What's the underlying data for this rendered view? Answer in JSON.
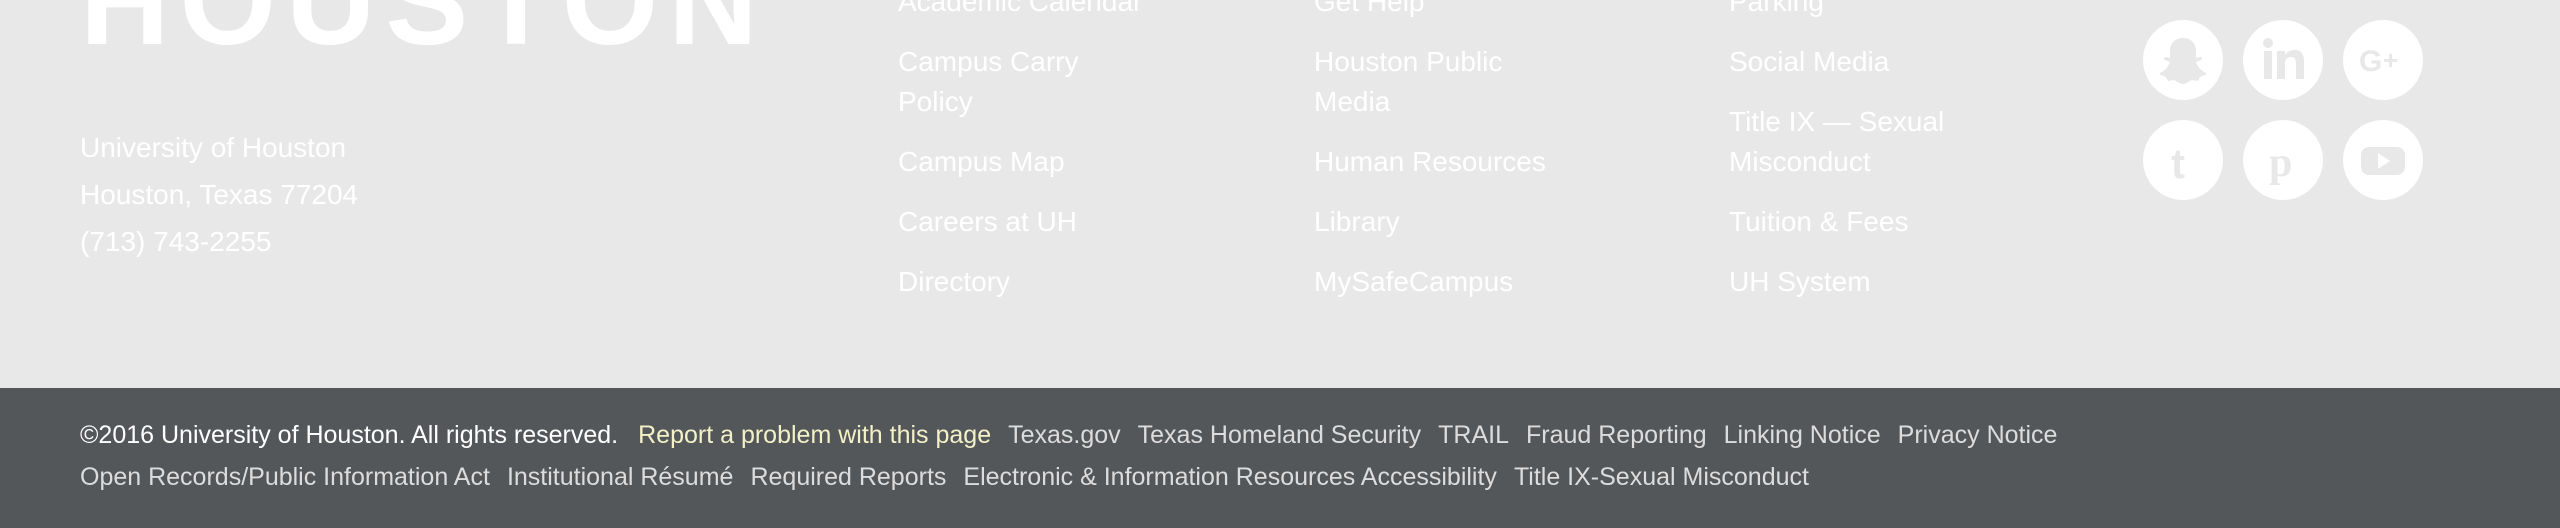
{
  "brand": {
    "logo_text": "HOUSTON"
  },
  "address": {
    "line1": "University of Houston",
    "line2": "Houston, Texas 77204",
    "phone": "(713) 743-2255"
  },
  "columns": [
    {
      "links": [
        "Academic Calendar",
        "Campus Carry Policy",
        "Campus Map",
        "Careers at UH",
        "Directory"
      ]
    },
    {
      "links": [
        "Get Help",
        "Houston Public Media",
        "Human Resources",
        "Library",
        "MySafeCampus"
      ]
    },
    {
      "links": [
        "Parking",
        "Social Media",
        "Title IX — Sexual Misconduct",
        "Tuition & Fees",
        "UH System"
      ]
    }
  ],
  "social": {
    "icons": [
      "snapchat-icon",
      "linkedin-icon",
      "google-plus-icon",
      "tumblr-icon",
      "pinterest-icon",
      "youtube-icon"
    ]
  },
  "legal": {
    "copyright": "©2016 University of Houston. All rights reserved.",
    "report_link": "Report a problem with this page",
    "links_row1": [
      "Texas.gov",
      "Texas Homeland Security",
      "TRAIL",
      "Fraud Reporting",
      "Linking Notice",
      "Privacy Notice"
    ],
    "links_row2": [
      "Open Records/Public Information Act",
      "Institutional Résumé",
      "Required Reports",
      "Electronic & Information Resources Accessibility",
      "Title IX-Sexual Misconduct"
    ]
  },
  "colors": {
    "upper_background": "#e8e8e8",
    "lower_background": "#54575a",
    "link_text": "#ffffff",
    "report_link": "#f3f1c8"
  }
}
